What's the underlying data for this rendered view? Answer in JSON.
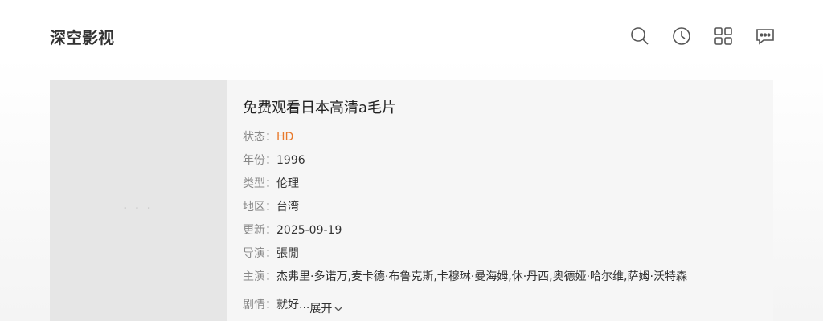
{
  "header": {
    "logo": "深空影视",
    "icons": [
      "search-icon",
      "history-icon",
      "grid-icon",
      "message-icon"
    ]
  },
  "detail": {
    "title": "免费观看日本高清a毛片",
    "poster_placeholder": "· · ·",
    "fields": {
      "status": {
        "label": "状态：",
        "value": "HD"
      },
      "year": {
        "label": "年份：",
        "value": "1996"
      },
      "genre": {
        "label": "类型：",
        "value": "伦理"
      },
      "region": {
        "label": "地区：",
        "value": "台湾"
      },
      "updated": {
        "label": "更新：",
        "value": "2025-09-19"
      },
      "director": {
        "label": "导演：",
        "value": "張閒"
      },
      "cast": {
        "label": "主演：",
        "value": "杰弗里·多诺万,麦卡德·布鲁克斯,卡穆琳·曼海姆,休·丹西,奥德娅·哈尔维,萨姆·沃特森"
      },
      "plot": {
        "label": "剧情：",
        "value": "就好...",
        "expand": "展开"
      }
    }
  },
  "colors": {
    "status": "#e8792b",
    "label": "#888888",
    "poster_bg": "#e6e6e6",
    "card_bg": "#f6f6f6"
  }
}
